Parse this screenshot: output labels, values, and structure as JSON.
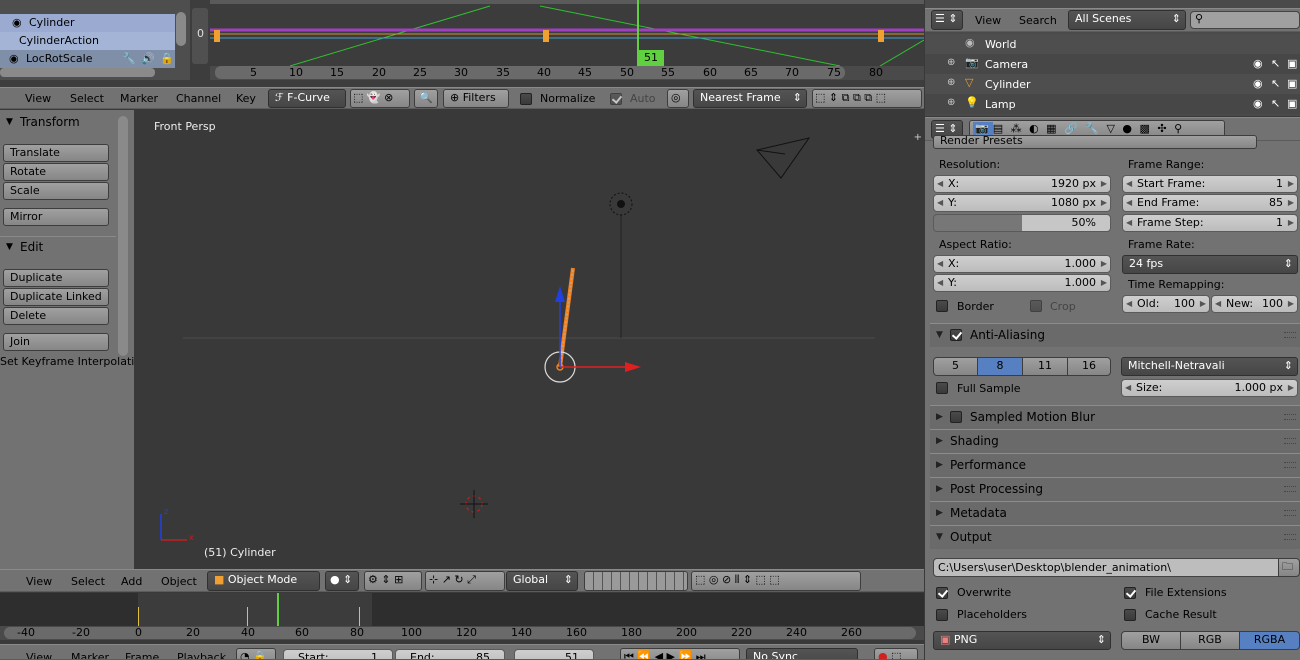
{
  "dopesheet": {
    "channels": [
      "Cylinder",
      "CylinderAction",
      "LocRotScale"
    ],
    "zero_label": "0",
    "current_frame": "51",
    "ticks": [
      "5",
      "10",
      "15",
      "20",
      "25",
      "30",
      "35",
      "40",
      "45",
      "50",
      "55",
      "60",
      "65",
      "70",
      "75",
      "80"
    ]
  },
  "graph_header": {
    "menus": [
      "View",
      "Select",
      "Marker",
      "Channel",
      "Key"
    ],
    "mode": "F-Curve",
    "filters": "Filters",
    "normalize": "Normalize",
    "auto": "Auto",
    "snap": "Nearest Frame"
  },
  "outliner": {
    "menus": [
      "View",
      "Search"
    ],
    "scene_select": "All Scenes",
    "items": [
      "World",
      "Camera",
      "Cylinder",
      "Lamp"
    ]
  },
  "toolshelf": {
    "transform_title": "Transform",
    "transform_buttons": [
      "Translate",
      "Rotate",
      "Scale"
    ],
    "mirror": "Mirror",
    "edit_title": "Edit",
    "edit_buttons": [
      "Duplicate",
      "Duplicate Linked",
      "Delete"
    ],
    "join": "Join",
    "operator_label": "Set Keyframe Interpolati"
  },
  "viewport": {
    "view_name": "Front Persp",
    "object_label": "(51) Cylinder"
  },
  "viewport_header": {
    "menus": [
      "View",
      "Select",
      "Add",
      "Object"
    ],
    "mode": "Object Mode",
    "orientation": "Global"
  },
  "timeline": {
    "ticks": [
      "-40",
      "-20",
      "0",
      "20",
      "40",
      "60",
      "80",
      "100",
      "120",
      "140",
      "160",
      "180",
      "200",
      "220",
      "240",
      "260"
    ],
    "menus": [
      "View",
      "Marker",
      "Frame",
      "Playback"
    ],
    "start_label": "Start:",
    "start_value": "1",
    "end_label": "End:",
    "end_value": "85",
    "current": "51",
    "sync": "No Sync"
  },
  "properties": {
    "render_presets": "Render Presets",
    "resolution": {
      "title": "Resolution:",
      "x_label": "X:",
      "x_value": "1920 px",
      "y_label": "Y:",
      "y_value": "1080 px",
      "percent": "50%"
    },
    "frame_range": {
      "title": "Frame Range:",
      "start_label": "Start Frame:",
      "start_value": "1",
      "end_label": "End Frame:",
      "end_value": "85",
      "step_label": "Frame Step:",
      "step_value": "1"
    },
    "aspect": {
      "title": "Aspect Ratio:",
      "x_label": "X:",
      "x_value": "1.000",
      "y_label": "Y:",
      "y_value": "1.000"
    },
    "frame_rate": {
      "title": "Frame Rate:",
      "value": "24 fps"
    },
    "time_remap": {
      "title": "Time Remapping:",
      "old_label": "Old:",
      "old_value": "100",
      "new_label": "New:",
      "new_value": "100"
    },
    "border": "Border",
    "crop": "Crop",
    "aa": {
      "title": "Anti-Aliasing",
      "samples": [
        "5",
        "8",
        "11",
        "16"
      ],
      "filter": "Mitchell-Netravali",
      "full_sample": "Full Sample",
      "size_label": "Size:",
      "size_value": "1.000 px"
    },
    "panels": [
      "Sampled Motion Blur",
      "Shading",
      "Performance",
      "Post Processing",
      "Metadata"
    ],
    "output": {
      "title": "Output",
      "path": "C:\\Users\\user\\Desktop\\blender_animation\\",
      "overwrite": "Overwrite",
      "file_extensions": "File Extensions",
      "placeholders": "Placeholders",
      "cache_result": "Cache Result",
      "format": "PNG",
      "color_modes": [
        "BW",
        "RGB",
        "RGBA"
      ]
    }
  },
  "colors": {
    "accent": "#5680c2",
    "keyframe": "#f0a030",
    "selection": "#f08020",
    "timeline_frame": "#60d040"
  }
}
